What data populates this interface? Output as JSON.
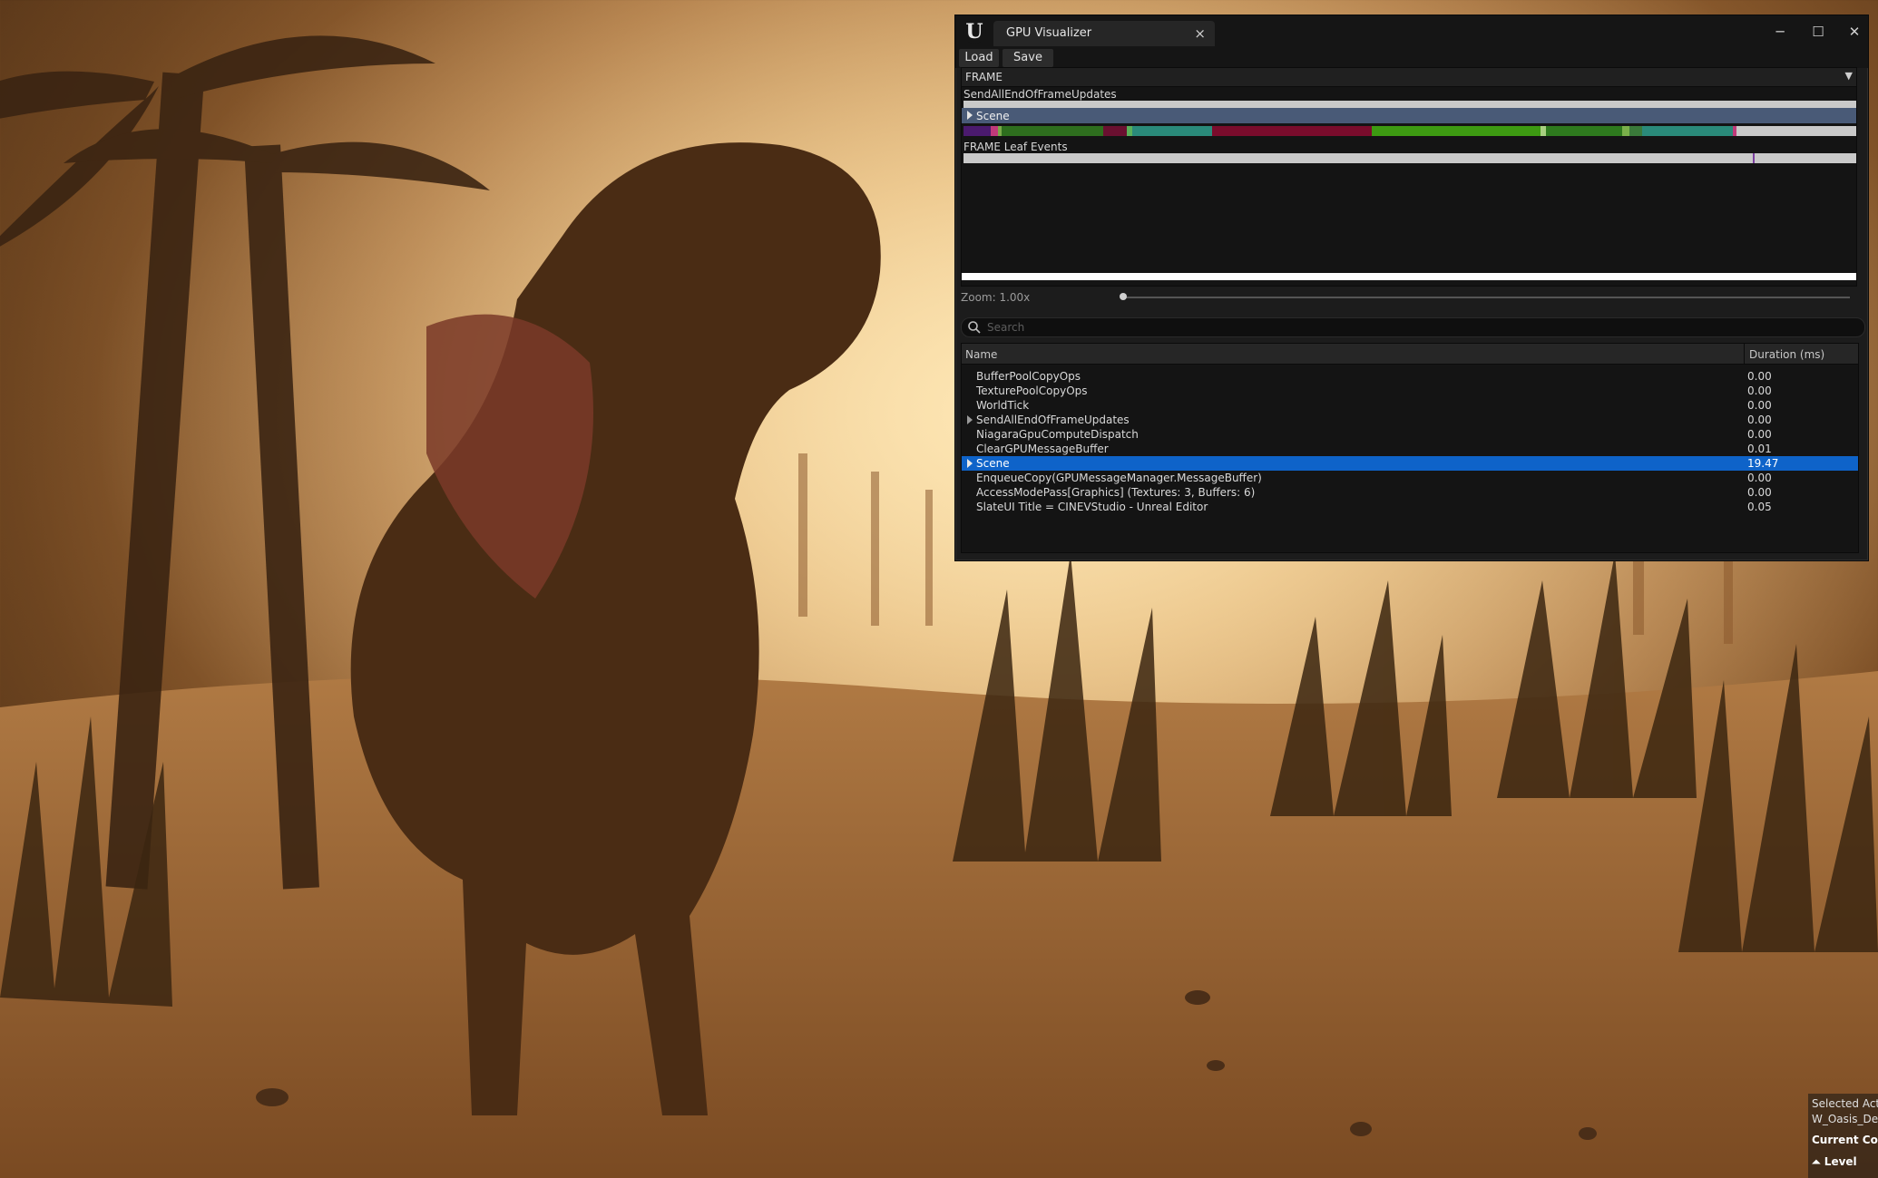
{
  "window": {
    "tab_title": "GPU Visualizer",
    "close_glyph": "×",
    "minimize_glyph": "─",
    "maximize_glyph": "☐",
    "window_close_glyph": "✕",
    "logo_glyph": "U"
  },
  "toolbar": {
    "load_label": "Load",
    "save_label": "Save"
  },
  "frame": {
    "selector_value": "FRAME",
    "track1_label": "SendAllEndOfFrameUpdates",
    "scene_label": "Scene",
    "leaf_label": "FRAME Leaf Events"
  },
  "zoom": {
    "label": "Zoom: 1.00x",
    "level": 1.0
  },
  "search": {
    "placeholder": "Search",
    "value": ""
  },
  "tree": {
    "columns": {
      "name": "Name",
      "duration": "Duration (ms)"
    },
    "rows": [
      {
        "name": "BufferPoolCopyOps",
        "duration": "0.00",
        "expandable": false,
        "selected": false
      },
      {
        "name": "TexturePoolCopyOps",
        "duration": "0.00",
        "expandable": false,
        "selected": false
      },
      {
        "name": "WorldTick",
        "duration": "0.00",
        "expandable": false,
        "selected": false
      },
      {
        "name": "SendAllEndOfFrameUpdates",
        "duration": "0.00",
        "expandable": true,
        "selected": false
      },
      {
        "name": "NiagaraGpuComputeDispatch",
        "duration": "0.00",
        "expandable": false,
        "selected": false
      },
      {
        "name": "ClearGPUMessageBuffer",
        "duration": "0.01",
        "expandable": false,
        "selected": false
      },
      {
        "name": "Scene",
        "duration": "19.47",
        "expandable": true,
        "selected": true
      },
      {
        "name": "EnqueueCopy(GPUMessageManager.MessageBuffer)",
        "duration": "0.00",
        "expandable": false,
        "selected": false
      },
      {
        "name": "AccessModePass[Graphics] (Textures: 3, Buffers: 6)",
        "duration": "0.00",
        "expandable": false,
        "selected": false
      },
      {
        "name": "SlateUI Title = CINEVStudio - Unreal Editor",
        "duration": "0.05",
        "expandable": false,
        "selected": false
      }
    ]
  },
  "overlay": {
    "line1": "Selected Act",
    "line2": "W_Oasis_De",
    "line3": "Current Cont",
    "line4": "Level"
  },
  "colors": {
    "window_bg": "#1c1c1c",
    "selection": "#0e63c9",
    "scene_row": "#495a77",
    "bar_light": "#c9c9c9"
  }
}
